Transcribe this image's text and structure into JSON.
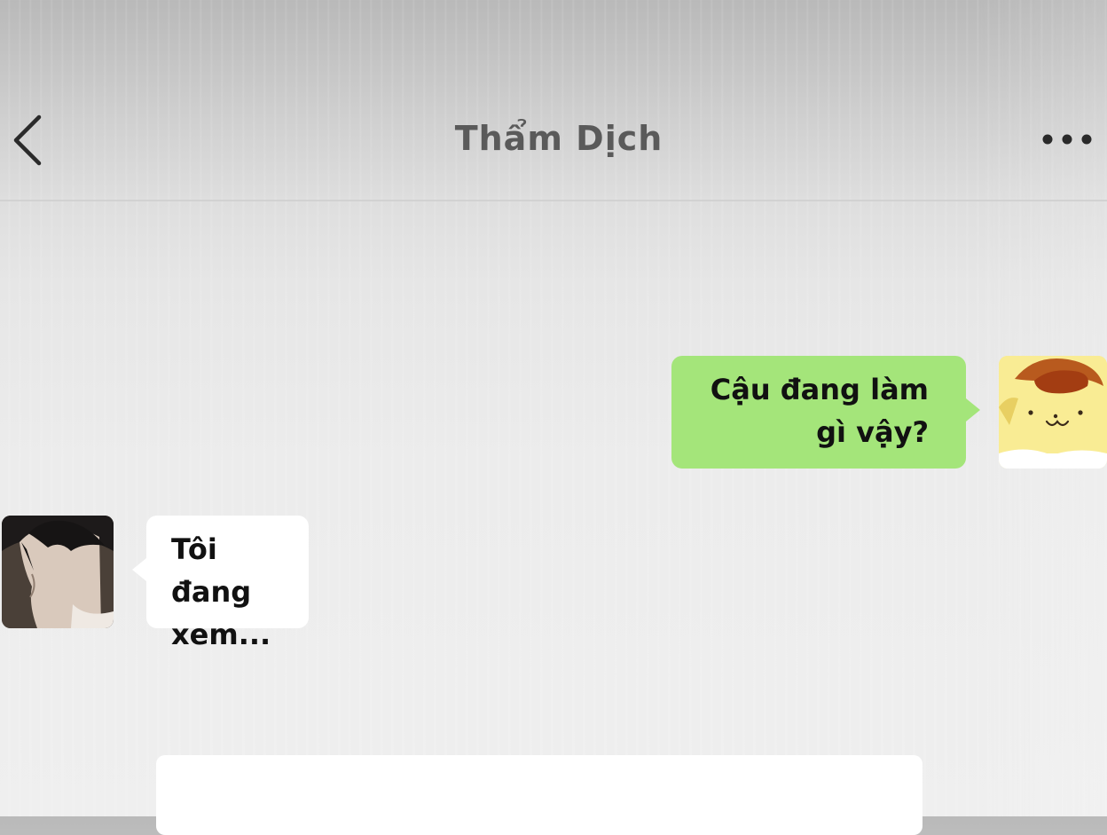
{
  "header": {
    "title": "Thẩm Dịch",
    "back_icon": "chevron-left-icon",
    "more_icon": "more-horizontal-icon"
  },
  "messages": [
    {
      "direction": "outgoing",
      "lines": [
        "Cậu đang làm",
        "gì vậy?"
      ],
      "bubble_color": "#a4e57a",
      "avatar": "pompompurin-avatar"
    },
    {
      "direction": "incoming",
      "lines": [
        "Tôi đang",
        "xem..."
      ],
      "bubble_color": "#ffffff",
      "avatar": "dark-haired-man-avatar"
    }
  ],
  "composer": {
    "placeholder": ""
  },
  "colors": {
    "title_text": "#5a5a5a",
    "outgoing_bubble": "#a4e57a",
    "incoming_bubble": "#ffffff",
    "background": "#ececec"
  }
}
